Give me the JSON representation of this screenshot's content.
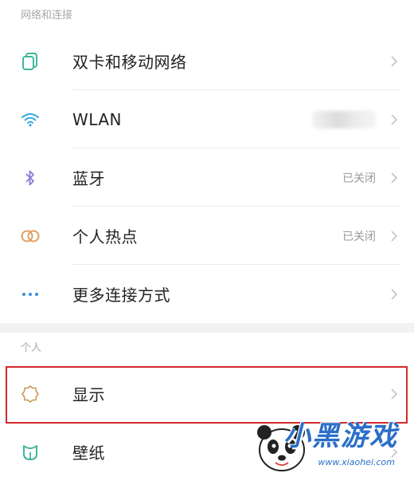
{
  "sections": {
    "network_header": "网络和连接",
    "personal_header": "个人"
  },
  "network_items": [
    {
      "label": "双卡和移动网络",
      "icon": "dual-sim-icon",
      "status": ""
    },
    {
      "label": "WLAN",
      "icon": "wifi-icon",
      "status": ""
    },
    {
      "label": "蓝牙",
      "icon": "bluetooth-icon",
      "status": "已关闭"
    },
    {
      "label": "个人热点",
      "icon": "hotspot-icon",
      "status": "已关闭"
    },
    {
      "label": "更多连接方式",
      "icon": "more-dots-icon",
      "status": ""
    }
  ],
  "personal_items": [
    {
      "label": "显示",
      "icon": "display-brightness-icon",
      "status": ""
    },
    {
      "label": "壁纸",
      "icon": "wallpaper-icon",
      "status": ""
    }
  ],
  "watermark": {
    "text": "小黑游戏",
    "url": "www.xiaohei.com"
  },
  "colors": {
    "highlight_border": "#d42a2a",
    "icon_green": "#3fb59a",
    "icon_wifi": "#33a9e0",
    "icon_bluetooth": "#8f7ad8",
    "icon_hotspot": "#e0a061",
    "icon_more": "#3c8fe0",
    "icon_display": "#c79a56",
    "icon_wallpaper": "#3fb59a"
  }
}
